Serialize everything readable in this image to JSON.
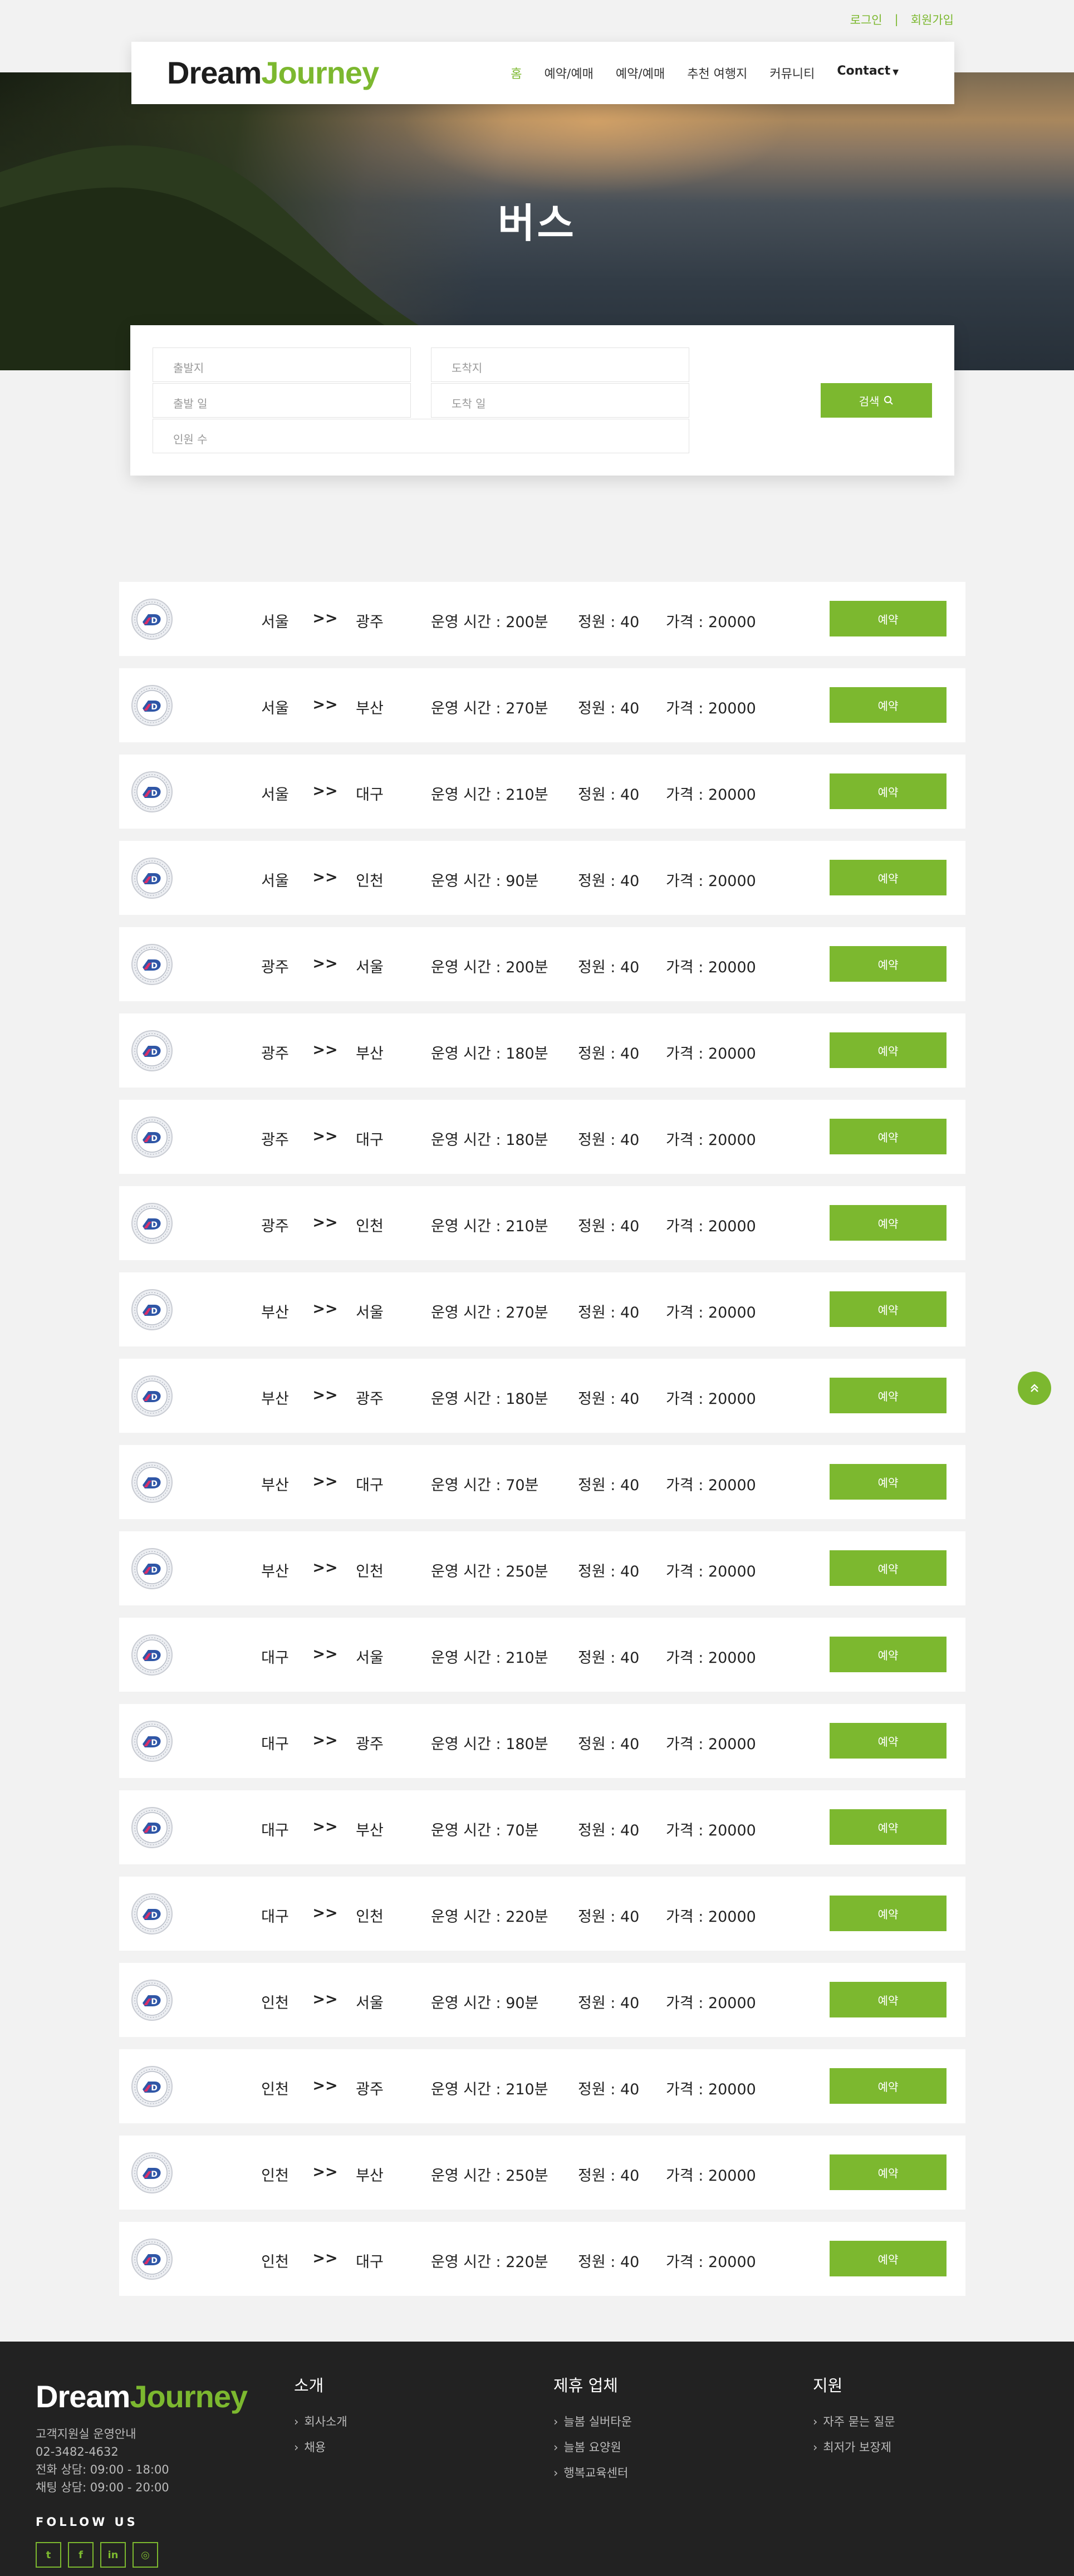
{
  "top_links": {
    "login": "로그인",
    "separator": "|",
    "signup": "회원가입"
  },
  "brand": {
    "part1": "Dream",
    "part2": "Journey"
  },
  "nav": {
    "items": [
      "홈",
      "예약/예매",
      "예약/예매",
      "추천 여행지",
      "커뮤니티"
    ],
    "contact": "Contact",
    "active_index": 0
  },
  "hero": {
    "title": "버스"
  },
  "search": {
    "departure_placeholder": "출발지",
    "arrival_placeholder": "도착지",
    "departure_date_placeholder": "출발 일",
    "arrival_date_placeholder": "도착 일",
    "people_placeholder": "인원 수",
    "button_label": "검색"
  },
  "list": {
    "arrow": ">>",
    "duration_prefix": "운영 시간 : ",
    "duration_unit": "분",
    "capacity_prefix": "정원 : ",
    "price_prefix": "가격 : ",
    "book_label": "예약",
    "routes": [
      {
        "from": "서울",
        "to": "광주",
        "duration": "200",
        "capacity": "40",
        "price": "20000"
      },
      {
        "from": "서울",
        "to": "부산",
        "duration": "270",
        "capacity": "40",
        "price": "20000"
      },
      {
        "from": "서울",
        "to": "대구",
        "duration": "210",
        "capacity": "40",
        "price": "20000"
      },
      {
        "from": "서울",
        "to": "인천",
        "duration": "90",
        "capacity": "40",
        "price": "20000"
      },
      {
        "from": "광주",
        "to": "서울",
        "duration": "200",
        "capacity": "40",
        "price": "20000"
      },
      {
        "from": "광주",
        "to": "부산",
        "duration": "180",
        "capacity": "40",
        "price": "20000"
      },
      {
        "from": "광주",
        "to": "대구",
        "duration": "180",
        "capacity": "40",
        "price": "20000"
      },
      {
        "from": "광주",
        "to": "인천",
        "duration": "210",
        "capacity": "40",
        "price": "20000"
      },
      {
        "from": "부산",
        "to": "서울",
        "duration": "270",
        "capacity": "40",
        "price": "20000"
      },
      {
        "from": "부산",
        "to": "광주",
        "duration": "180",
        "capacity": "40",
        "price": "20000"
      },
      {
        "from": "부산",
        "to": "대구",
        "duration": "70",
        "capacity": "40",
        "price": "20000"
      },
      {
        "from": "부산",
        "to": "인천",
        "duration": "250",
        "capacity": "40",
        "price": "20000"
      },
      {
        "from": "대구",
        "to": "서울",
        "duration": "210",
        "capacity": "40",
        "price": "20000"
      },
      {
        "from": "대구",
        "to": "광주",
        "duration": "180",
        "capacity": "40",
        "price": "20000"
      },
      {
        "from": "대구",
        "to": "부산",
        "duration": "70",
        "capacity": "40",
        "price": "20000"
      },
      {
        "from": "대구",
        "to": "인천",
        "duration": "220",
        "capacity": "40",
        "price": "20000"
      },
      {
        "from": "인천",
        "to": "서울",
        "duration": "90",
        "capacity": "40",
        "price": "20000"
      },
      {
        "from": "인천",
        "to": "광주",
        "duration": "210",
        "capacity": "40",
        "price": "20000"
      },
      {
        "from": "인천",
        "to": "부산",
        "duration": "250",
        "capacity": "40",
        "price": "20000"
      },
      {
        "from": "인천",
        "to": "대구",
        "duration": "220",
        "capacity": "40",
        "price": "20000"
      }
    ]
  },
  "footer": {
    "info_lines": [
      "고객지원실 운영안내",
      "02-3482-4632",
      "전화 상담: 09:00 - 18:00",
      "채팅 상담: 09:00 - 20:00"
    ],
    "follow_us": "FOLLOW US",
    "socials": [
      "twitter-icon",
      "facebook-icon",
      "linkedin-icon",
      "instagram-icon"
    ],
    "columns": [
      {
        "title": "소개",
        "links": [
          "회사소개",
          "채용"
        ]
      },
      {
        "title": "제휴 업체",
        "links": [
          "늘봄 실버타운",
          "늘봄 요양원",
          "행복교육센터"
        ]
      },
      {
        "title": "지원",
        "links": [
          "자주 묻는 질문",
          "최저가 보장제"
        ]
      }
    ]
  },
  "colors": {
    "accent": "#7cb82f",
    "footer_bg": "#222222",
    "page_bg": "#f2f2f2"
  }
}
